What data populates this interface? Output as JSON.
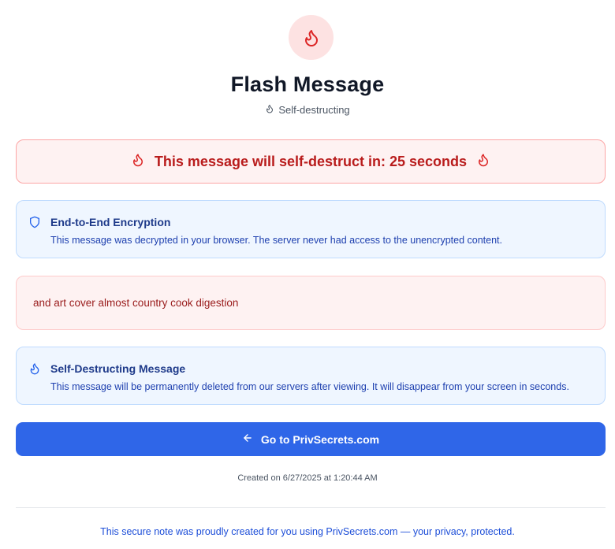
{
  "header": {
    "icon": "flame-icon",
    "title": "Flash Message",
    "subtitle": "Self-destructing",
    "subtitle_icon": "flame-icon"
  },
  "timer": {
    "text": "This message will self-destruct in: 25 seconds",
    "icon": "flame-icon"
  },
  "encryption_notice": {
    "icon": "shield-icon",
    "title": "End-to-End Encryption",
    "text": "This message was decrypted in your browser. The server never had access to the unencrypted content."
  },
  "message": {
    "content": "and art cover almost country cook digestion"
  },
  "self_destruct_notice": {
    "icon": "flame-icon",
    "title": "Self-Destructing Message",
    "text": "This message will be permanently deleted from our servers after viewing. It will disappear from your screen in seconds."
  },
  "actions": {
    "go_button_label": "Go to PrivSecrets.com",
    "go_button_icon": "arrow-left-icon"
  },
  "meta": {
    "created": "Created on 6/27/2025 at 1:20:44 AM"
  },
  "footer": {
    "text_before": "This secure note was proudly created for you using ",
    "link": "PrivSecrets.com",
    "text_after": " — your privacy, protected."
  },
  "colors": {
    "accent_red": "#dc2626",
    "accent_blue": "#2f66e8",
    "info_bg": "#eff6ff",
    "alert_bg": "#fef2f2"
  }
}
